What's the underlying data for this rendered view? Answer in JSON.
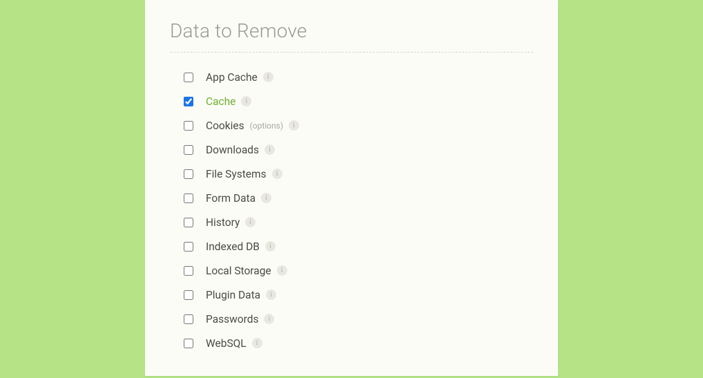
{
  "title": "Data to Remove",
  "info_glyph": "i",
  "options": [
    {
      "key": "app-cache",
      "label": "App Cache",
      "checked": false,
      "extra": null
    },
    {
      "key": "cache",
      "label": "Cache",
      "checked": true,
      "extra": null
    },
    {
      "key": "cookies",
      "label": "Cookies",
      "checked": false,
      "extra": "(options)"
    },
    {
      "key": "downloads",
      "label": "Downloads",
      "checked": false,
      "extra": null
    },
    {
      "key": "file-systems",
      "label": "File Systems",
      "checked": false,
      "extra": null
    },
    {
      "key": "form-data",
      "label": "Form Data",
      "checked": false,
      "extra": null
    },
    {
      "key": "history",
      "label": "History",
      "checked": false,
      "extra": null
    },
    {
      "key": "indexed-db",
      "label": "Indexed DB",
      "checked": false,
      "extra": null
    },
    {
      "key": "local-storage",
      "label": "Local Storage",
      "checked": false,
      "extra": null
    },
    {
      "key": "plugin-data",
      "label": "Plugin Data",
      "checked": false,
      "extra": null
    },
    {
      "key": "passwords",
      "label": "Passwords",
      "checked": false,
      "extra": null
    },
    {
      "key": "websql",
      "label": "WebSQL",
      "checked": false,
      "extra": null
    }
  ]
}
